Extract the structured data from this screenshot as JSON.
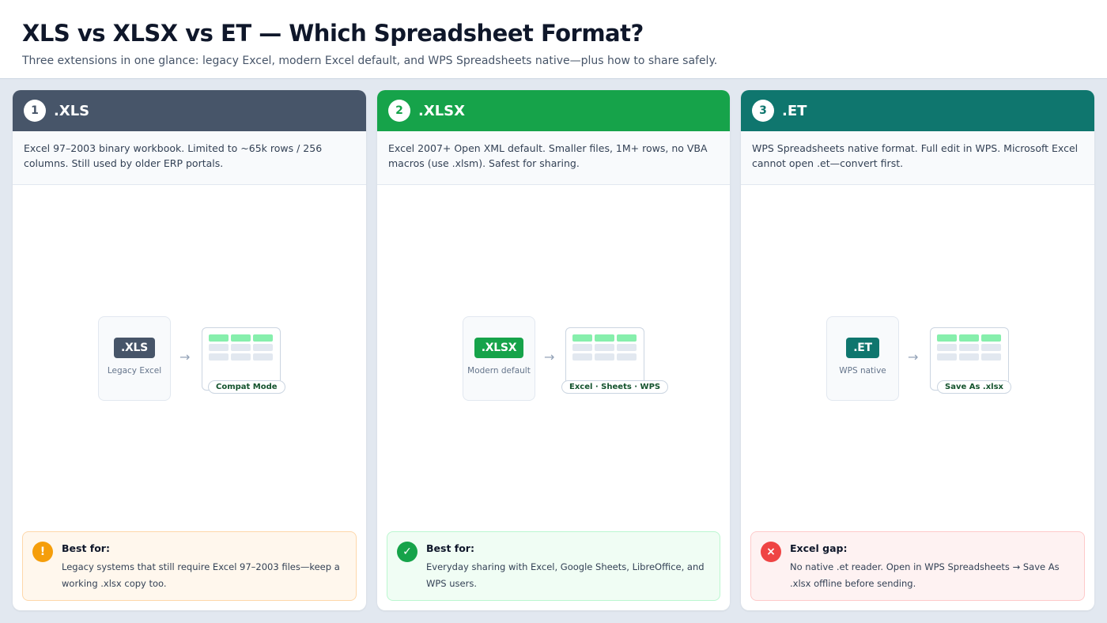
{
  "header": {
    "title": "XLS vs XLSX vs ET — Which Spreadsheet Format?",
    "subtitle": "Three extensions in one glance: legacy Excel, modern Excel default, and WPS Spreadsheets native—plus how to share safely."
  },
  "cards": [
    {
      "number": "1",
      "title": ".XLS",
      "color": "#475569",
      "description": "Excel 97–2003 binary workbook. Limited to ~65k rows / 256 columns. Still used by older ERP portals.",
      "ext_label": ".XLS",
      "source_caption": "Legacy Excel",
      "arrow": "→",
      "sheet_tag": "Compat Mode",
      "note": {
        "icon": "warning-icon",
        "icon_glyph": "!",
        "icon_color": "#f59e0b",
        "bg": "#fff7ed",
        "border": "#fed7aa",
        "title": "Best for:",
        "body": "Legacy systems that still require Excel 97–2003 files—keep a working .xlsx copy too."
      }
    },
    {
      "number": "2",
      "title": ".XLSX",
      "color": "#16a34a",
      "description": "Excel 2007+ Open XML default. Smaller files, 1M+ rows, no VBA macros (use .xlsm). Safest for sharing.",
      "ext_label": ".XLSX",
      "source_caption": "Modern default",
      "arrow": "→",
      "sheet_tag": "Excel · Sheets · WPS",
      "note": {
        "icon": "check-icon",
        "icon_glyph": "✓",
        "icon_color": "#16a34a",
        "bg": "#f0fdf4",
        "border": "#bbf7d0",
        "title": "Best for:",
        "body": "Everyday sharing with Excel, Google Sheets, LibreOffice, and WPS users."
      }
    },
    {
      "number": "3",
      "title": ".ET",
      "color": "#0f766e",
      "description": "WPS Spreadsheets native format. Full edit in WPS. Microsoft Excel cannot open .et—convert first.",
      "ext_label": ".ET",
      "source_caption": "WPS native",
      "arrow": "→",
      "sheet_tag": "Save As .xlsx",
      "note": {
        "icon": "error-icon",
        "icon_glyph": "×",
        "icon_color": "#ef4444",
        "bg": "#fef2f2",
        "border": "#fecaca",
        "title": "Excel gap:",
        "body": "No native .et reader. Open in WPS Spreadsheets → Save As .xlsx offline before sending."
      }
    }
  ]
}
